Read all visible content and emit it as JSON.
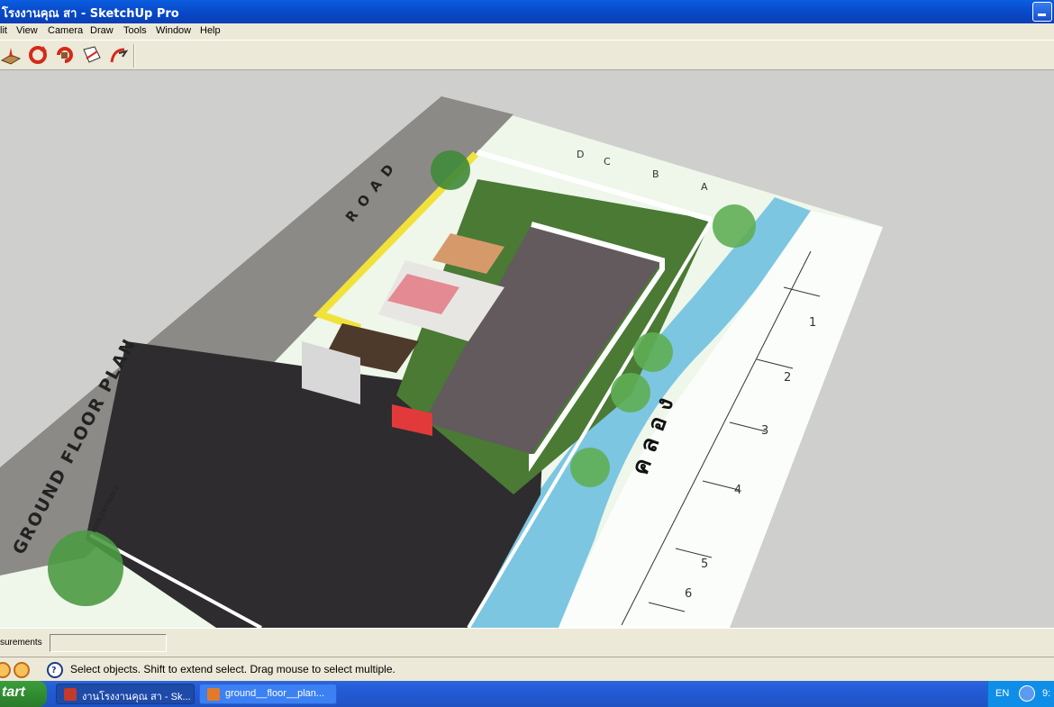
{
  "window": {
    "title": "โรงงานคุณ สา - SketchUp Pro"
  },
  "menu": [
    "lit",
    "View",
    "Camera",
    "Draw",
    "Tools",
    "Window",
    "Help"
  ],
  "toolbar": {
    "icons": [
      "sandbox-icon",
      "orbit-icon",
      "rotate-icon",
      "section-icon",
      "walk-icon"
    ]
  },
  "model": {
    "road_label": "R O A D",
    "plan_label": "GROUND FLOOR PLAN",
    "entrance_label": "MAIN ENTRANCE",
    "canal_label": "ค ล อ ง",
    "grid_letters": [
      "A",
      "B",
      "C",
      "D"
    ],
    "grid_numbers": [
      "1",
      "2",
      "3",
      "4",
      "5",
      "6"
    ]
  },
  "measurements": {
    "label": "surements",
    "value": ""
  },
  "status": {
    "message": "Select objects. Shift to extend select. Drag mouse to select multiple."
  },
  "taskbar": {
    "start_label": "tart",
    "tasks": [
      {
        "label": "งานโรงงานคุณ สา - Sk..."
      },
      {
        "label": "ground__floor__plan..."
      }
    ],
    "lang": "EN",
    "clock": "9:"
  },
  "colors": {
    "title_bar": "#0a5ee0",
    "road": "#8c8a86",
    "parking": "#2e2c2e",
    "factory_floor": "#625a5c",
    "lawn": "#4a7a34",
    "canal": "#7cc6e2",
    "highlight": "#f1e23a"
  }
}
